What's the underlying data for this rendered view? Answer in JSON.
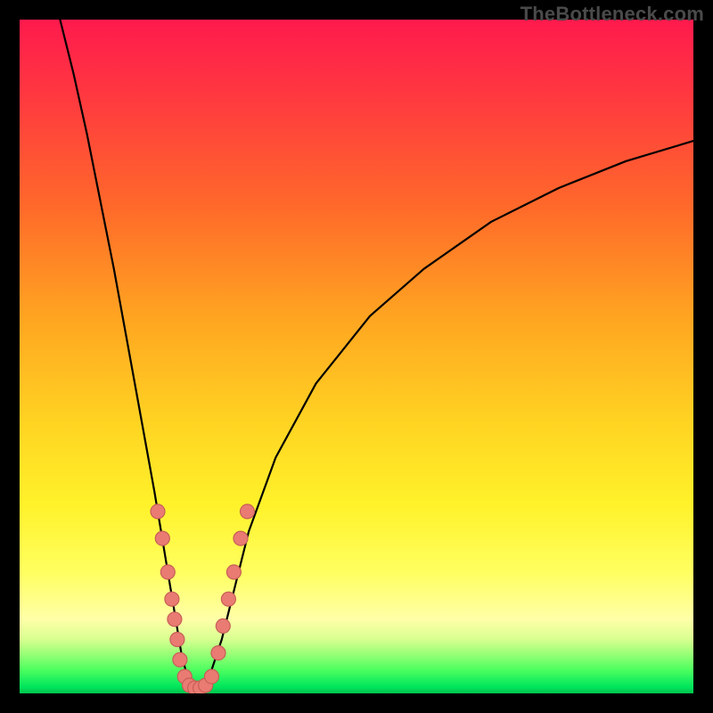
{
  "watermark": "TheBottleneck.com",
  "chart_data": {
    "type": "line",
    "title": "",
    "xlabel": "",
    "ylabel": "",
    "xlim": [
      0,
      100
    ],
    "ylim": [
      0,
      100
    ],
    "curve_left": [
      {
        "x": 6,
        "y": 100
      },
      {
        "x": 8,
        "y": 92
      },
      {
        "x": 10,
        "y": 83
      },
      {
        "x": 12,
        "y": 73
      },
      {
        "x": 14,
        "y": 63
      },
      {
        "x": 16,
        "y": 52
      },
      {
        "x": 18,
        "y": 41
      },
      {
        "x": 20,
        "y": 30
      },
      {
        "x": 21,
        "y": 24
      },
      {
        "x": 22,
        "y": 18
      },
      {
        "x": 23,
        "y": 12
      },
      {
        "x": 24,
        "y": 6
      },
      {
        "x": 25,
        "y": 2
      },
      {
        "x": 26,
        "y": 0
      }
    ],
    "curve_right": [
      {
        "x": 26,
        "y": 0
      },
      {
        "x": 28,
        "y": 2
      },
      {
        "x": 30,
        "y": 8
      },
      {
        "x": 32,
        "y": 16
      },
      {
        "x": 34,
        "y": 24
      },
      {
        "x": 38,
        "y": 35
      },
      {
        "x": 44,
        "y": 46
      },
      {
        "x": 52,
        "y": 56
      },
      {
        "x": 60,
        "y": 63
      },
      {
        "x": 70,
        "y": 70
      },
      {
        "x": 80,
        "y": 75
      },
      {
        "x": 90,
        "y": 79
      },
      {
        "x": 100,
        "y": 82
      }
    ],
    "series": [
      {
        "name": "data-points",
        "points": [
          {
            "x": 20.5,
            "y": 27
          },
          {
            "x": 21.2,
            "y": 23
          },
          {
            "x": 22.0,
            "y": 18
          },
          {
            "x": 22.6,
            "y": 14
          },
          {
            "x": 23.0,
            "y": 11
          },
          {
            "x": 23.4,
            "y": 8
          },
          {
            "x": 23.8,
            "y": 5
          },
          {
            "x": 24.5,
            "y": 2.5
          },
          {
            "x": 25.2,
            "y": 1.2
          },
          {
            "x": 26.0,
            "y": 0.8
          },
          {
            "x": 26.8,
            "y": 0.8
          },
          {
            "x": 27.6,
            "y": 1.2
          },
          {
            "x": 28.5,
            "y": 2.5
          },
          {
            "x": 29.5,
            "y": 6
          },
          {
            "x": 30.2,
            "y": 10
          },
          {
            "x": 31.0,
            "y": 14
          },
          {
            "x": 31.8,
            "y": 18
          },
          {
            "x": 32.8,
            "y": 23
          },
          {
            "x": 33.8,
            "y": 27
          }
        ]
      }
    ]
  }
}
